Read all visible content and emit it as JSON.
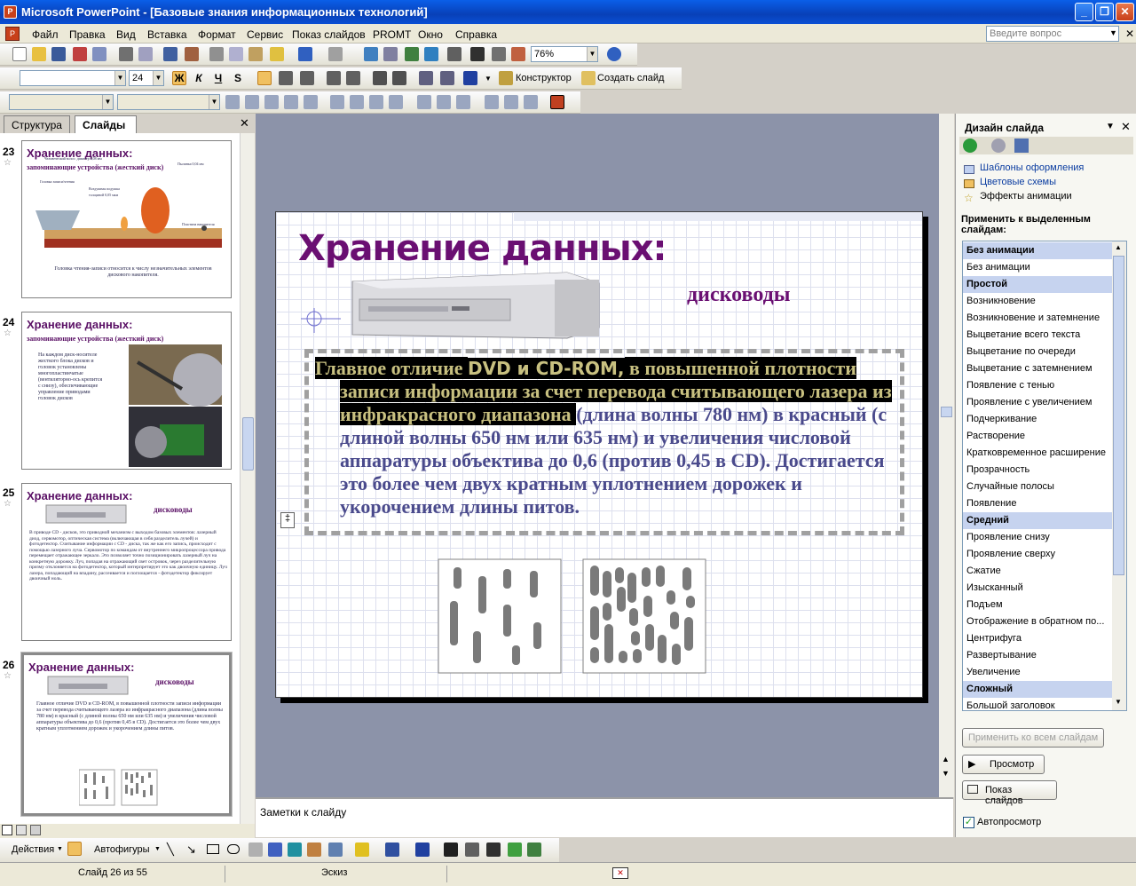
{
  "window": {
    "title": "Microsoft PowerPoint - [Базовые знания информационных технологий]"
  },
  "menu": [
    "Файл",
    "Правка",
    "Вид",
    "Вставка",
    "Формат",
    "Сервис",
    "Показ слайдов",
    "PROMT",
    "Окно",
    "Справка"
  ],
  "ask_placeholder": "Введите вопрос",
  "toolbar": {
    "zoom": "76%",
    "font_size": "24",
    "designer_label": "Конструктор",
    "new_slide_label": "Создать слайд"
  },
  "left_panel": {
    "tabs": [
      "Структура",
      "Слайды"
    ],
    "thumbs": [
      {
        "num": "23",
        "title": "Хранение данных:",
        "subtitle": "запоминающие устройства (жесткий диск)",
        "caption": "Головка чтения-записи относится к числу незначительных элементов дискового накопителя.",
        "labels": [
          "Человеческий волос: диаметр 0,08 мм",
          "Головка записи/чтения",
          "Пылинка 0,04 мм",
          "Воздушная подушка толщиной 0,05 мкм",
          "Пластина накопителя"
        ]
      },
      {
        "num": "24",
        "title": "Хранение данных:",
        "subtitle": "запоминающие устройства (жесткий диск)",
        "caption": "На каждом диск-носителе жесткого блока дисков и головок установлены многопластинчатые (вентиляторно-ось крепится с снизу), обеспечивающие управление приводами головок дисков"
      },
      {
        "num": "25",
        "title": "Хранение данных:",
        "subtitle": "дисководы",
        "caption": "В приводе CD - дисков, это приводной механизм с выходом базовых элементов: лазерный диод, сервомотор, оптическая система (включающая в себя разделитель лучей) и фотодетектор. Считывание информации с CD - диска, так же как его запись, происходит с помощью лазерного луча. Сервомотор по командам от внутреннего микропроцессора привода перемещает отражающее зеркало. Это позволяет точно позиционировать лазерный луч на конкретную дорожку. Луч, попадая на отражающий свет островок, через разделительную призму отклоняется на фотодетектор, который интерпретирует это как двоичную единицу. Луч лазера, попадающий на впадину, рассеивается и поглощается - фотодетектор фиксирует двоичный ноль."
      },
      {
        "num": "26",
        "title": "Хранение данных:",
        "subtitle": "дисководы",
        "caption": "Главное отличие DVD и CD-ROM, в повышенной плотности записи информации за счет перевода считывающего лазера из инфракрасного диапазона (длина волны 780 нм) в красный (с длиной волны 650 нм или 635 нм) и увеличения числовой аппаратуры объектива до 0,6 (против 0,45 в CD). Достигается это более чем двух кратным уплотнением дорожек и укорочением длины питов."
      }
    ]
  },
  "slide": {
    "title": "Хранение данных:",
    "subtitle": "дисководы",
    "body_hl_1": "Главное отличие ",
    "body_hl_2": "DVD и CD-ROM,",
    "body_hl_3": " в повышенной плотности записи информации за счет перевода считывающего лазера из инфракрасного диапазона ",
    "body_rest": "(длина волны 780 нм) в красный (с длиной волны 650 нм или 635 нм) и увеличения числовой аппаратуры объектива до 0,6 (против 0,45 в CD). Достигается это более чем двух кратным уплотнением дорожек и укорочением длины питов."
  },
  "notes_placeholder": "Заметки к слайду",
  "task_pane": {
    "title": "Дизайн слайда",
    "links": [
      "Шаблоны оформления",
      "Цветовые схемы",
      "Эффекты анимации"
    ],
    "apply_label": "Применить к выделенным слайдам:",
    "list": [
      {
        "text": "Без анимации",
        "header": true
      },
      {
        "text": "Без анимации",
        "header": false
      },
      {
        "text": "Простой",
        "header": true
      },
      {
        "text": "Возникновение",
        "header": false
      },
      {
        "text": "Возникновение и затемнение",
        "header": false
      },
      {
        "text": "Выцветание всего текста",
        "header": false
      },
      {
        "text": "Выцветание по очереди",
        "header": false
      },
      {
        "text": "Выцветание с затемнением",
        "header": false
      },
      {
        "text": "Появление с тенью",
        "header": false
      },
      {
        "text": "Проявление с увеличением",
        "header": false
      },
      {
        "text": "Подчеркивание",
        "header": false
      },
      {
        "text": "Растворение",
        "header": false
      },
      {
        "text": "Кратковременное расширение",
        "header": false
      },
      {
        "text": "Прозрачность",
        "header": false
      },
      {
        "text": "Случайные полосы",
        "header": false
      },
      {
        "text": "Появление",
        "header": false
      },
      {
        "text": "Средний",
        "header": true
      },
      {
        "text": "Проявление снизу",
        "header": false
      },
      {
        "text": "Проявление сверху",
        "header": false
      },
      {
        "text": "Сжатие",
        "header": false
      },
      {
        "text": "Изысканный",
        "header": false
      },
      {
        "text": "Подъем",
        "header": false
      },
      {
        "text": "Отображение в обратном по...",
        "header": false
      },
      {
        "text": "Центрифуга",
        "header": false
      },
      {
        "text": "Развертывание",
        "header": false
      },
      {
        "text": "Увеличение",
        "header": false
      },
      {
        "text": "Сложный",
        "header": true
      },
      {
        "text": "Большой заголовок",
        "header": false
      }
    ],
    "apply_all": "Применить ко всем слайдам",
    "preview": "Просмотр",
    "slideshow": "Показ слайдов",
    "autopreview": "Автопросмотр"
  },
  "drawing": {
    "actions": "Действия",
    "autoshapes": "Автофигуры"
  },
  "status": {
    "slide": "Слайд 26 из 55",
    "design": "Эскиз"
  }
}
